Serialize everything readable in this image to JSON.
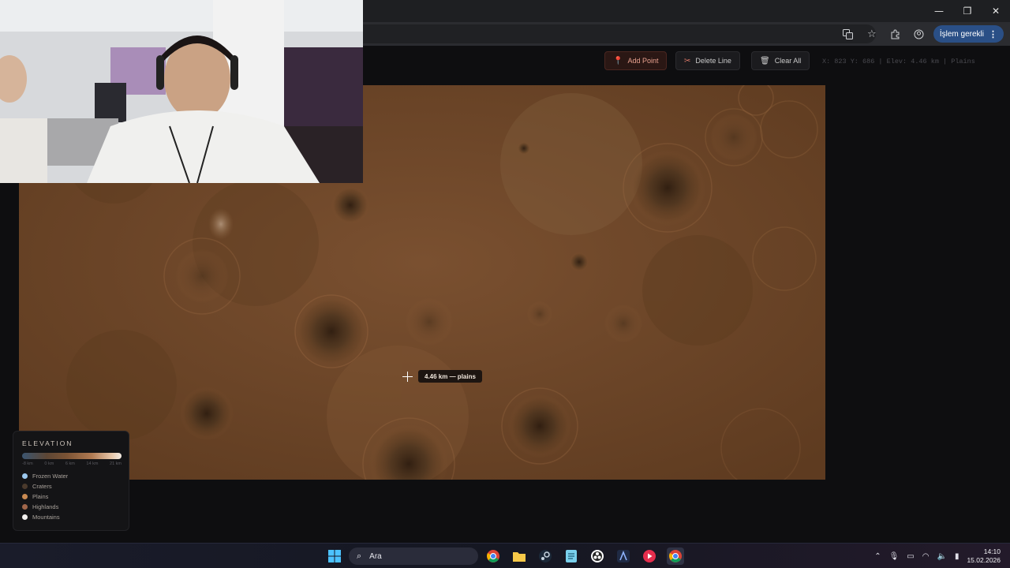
{
  "browser": {
    "window_controls": {
      "minimize": "—",
      "maximize": "❐",
      "close": "✕"
    },
    "toolbar_icons": [
      "translate-icon",
      "star-icon",
      "extensions-icon",
      "account-icon"
    ],
    "profile_label": "İşlem gerekli",
    "profile_menu": "⋮"
  },
  "app": {
    "toolbar": {
      "add_point": "Add Point",
      "delete_line": "Delete Line",
      "clear_all": "Clear All"
    },
    "coords_readout": "X: 823  Y: 686  |  Elev: 4.46 km  |  Plains",
    "cursor_tooltip": "4.46 km — plains",
    "legend": {
      "title": "ELEVATION",
      "ticks": [
        "-8 km",
        "0 km",
        "6 km",
        "14 km",
        "21 km"
      ],
      "items": [
        {
          "label": "Frozen Water",
          "color": "#9cc8ee"
        },
        {
          "label": "Craters",
          "color": "#4a3a2c"
        },
        {
          "label": "Plains",
          "color": "#c98a52"
        },
        {
          "label": "Highlands",
          "color": "#a0664a"
        },
        {
          "label": "Mountains",
          "color": "#f2f0ee"
        }
      ]
    },
    "colors": {
      "accent": "#e8a18f",
      "terrain": "#6a4424"
    }
  },
  "taskbar": {
    "search_placeholder": "Ara",
    "apps": [
      "windows-start-icon",
      "chrome-icon",
      "file-explorer-icon",
      "steam-icon",
      "notepad-icon",
      "obs-icon",
      "app-a-icon",
      "media-icon",
      "chrome-active-icon"
    ],
    "clock_time": "14:10",
    "clock_date": "15.02.2026"
  }
}
